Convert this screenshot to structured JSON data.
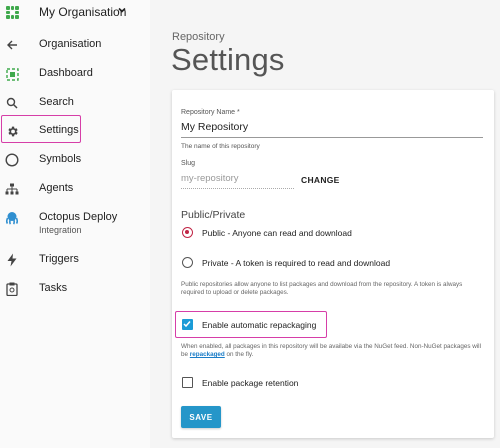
{
  "sidebar": {
    "org_name": "My Organisation",
    "logo_icon": "octopus-grid-logo",
    "items": [
      {
        "label": "Organisation",
        "icon": "arrow-left-icon",
        "sub": ""
      },
      {
        "label": "Dashboard",
        "icon": "dashboard-icon",
        "sub": ""
      },
      {
        "label": "Search",
        "icon": "search-icon",
        "sub": ""
      },
      {
        "label": "Settings",
        "icon": "gear-icon",
        "sub": "",
        "active": true
      },
      {
        "label": "Symbols",
        "icon": "circle-icon",
        "sub": ""
      },
      {
        "label": "Agents",
        "icon": "sitemap-icon",
        "sub": ""
      },
      {
        "label": "Octopus Deploy",
        "icon": "octopus-icon",
        "sub": "Integration"
      },
      {
        "label": "Triggers",
        "icon": "lightning-icon",
        "sub": ""
      },
      {
        "label": "Tasks",
        "icon": "clipboard-icon",
        "sub": ""
      }
    ]
  },
  "header": {
    "eyebrow": "Repository",
    "title": "Settings"
  },
  "form": {
    "repo_name": {
      "label": "Repository Name *",
      "value": "My Repository",
      "hint": "The name of this repository"
    },
    "slug": {
      "label": "Slug",
      "value": "my-repository",
      "change_label": "CHANGE"
    },
    "visibility": {
      "title": "Public/Private",
      "public_label": "Public - Anyone can read and download",
      "private_label": "Private - A token is required to read and download",
      "selected": "public",
      "info": "Public repositories allow anyone to list packages and download from the repository. A token is always required to upload or delete packages."
    },
    "repackaging": {
      "label": "Enable automatic repackaging",
      "checked": true,
      "info_before": "When enabled, all packages in this repository will be availabe via the NuGet feed. Non-NuGet packages will be ",
      "info_link": "repackaged",
      "info_after": " on the fly."
    },
    "retention": {
      "label": "Enable package retention",
      "checked": false
    },
    "save_label": "SAVE"
  },
  "colors": {
    "accent": "#2596c9",
    "highlight": "#d63ea8",
    "radio_selected": "#c02545",
    "link": "#1a7cc7",
    "brand_green": "#3fa94c"
  }
}
